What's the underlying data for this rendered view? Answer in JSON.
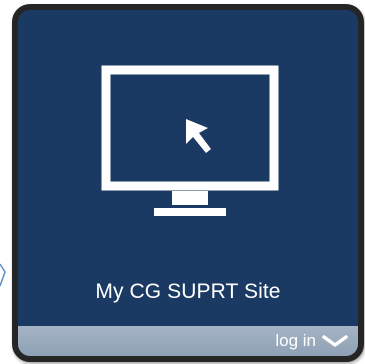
{
  "tile": {
    "title": "My CG SUPRT Site",
    "icon": "monitor-with-cursor-icon",
    "background_color": "#1b3a63",
    "border_color": "#252525"
  },
  "login_bar": {
    "label": "log in",
    "icon": "chevron-down-icon",
    "background_color": "#97a9bc"
  }
}
